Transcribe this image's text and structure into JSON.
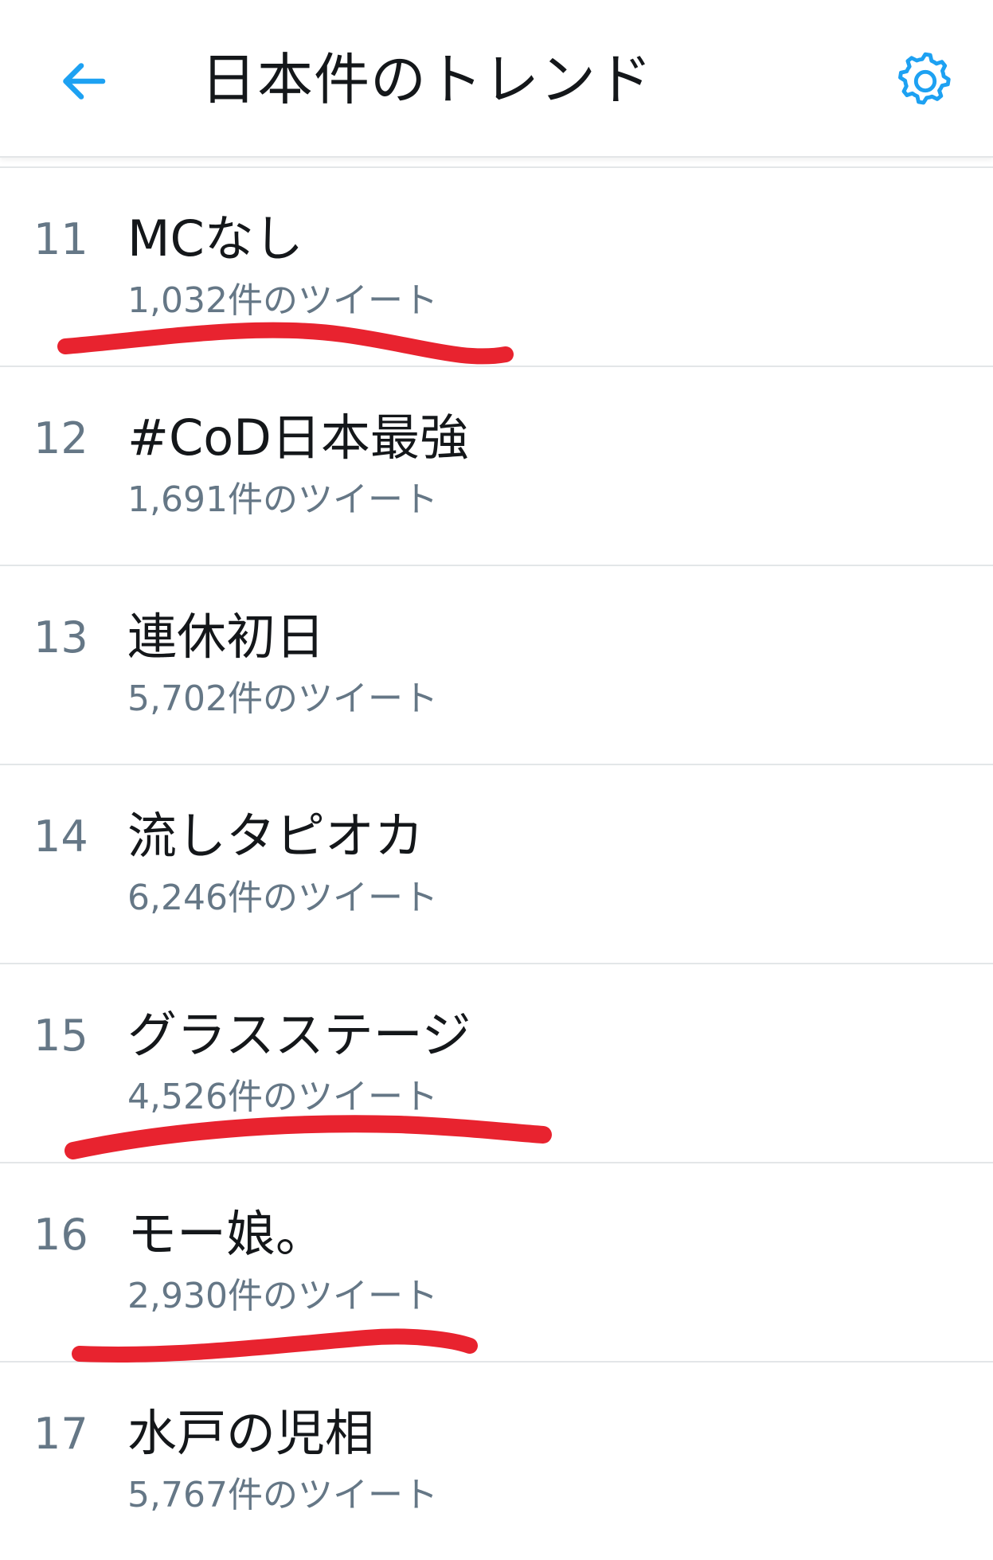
{
  "header": {
    "title": "日本件のトレンド",
    "back_icon": "arrow-left-icon",
    "settings_icon": "gear-icon",
    "accent_color": "#1da1f2"
  },
  "trends": [
    {
      "rank": "11",
      "name": "MCなし",
      "count": "1,032件のツイート"
    },
    {
      "rank": "12",
      "name": "#CoD日本最強",
      "count": "1,691件のツイート"
    },
    {
      "rank": "13",
      "name": "連休初日",
      "count": "5,702件のツイート"
    },
    {
      "rank": "14",
      "name": "流しタピオカ",
      "count": "6,246件のツイート"
    },
    {
      "rank": "15",
      "name": "グラスステージ",
      "count": "4,526件のツイート"
    },
    {
      "rank": "16",
      "name": "モー娘。",
      "count": "2,930件のツイート"
    },
    {
      "rank": "17",
      "name": "水戸の児相",
      "count": "5,767件のツイート"
    }
  ],
  "annotation_color": "#e8232f"
}
